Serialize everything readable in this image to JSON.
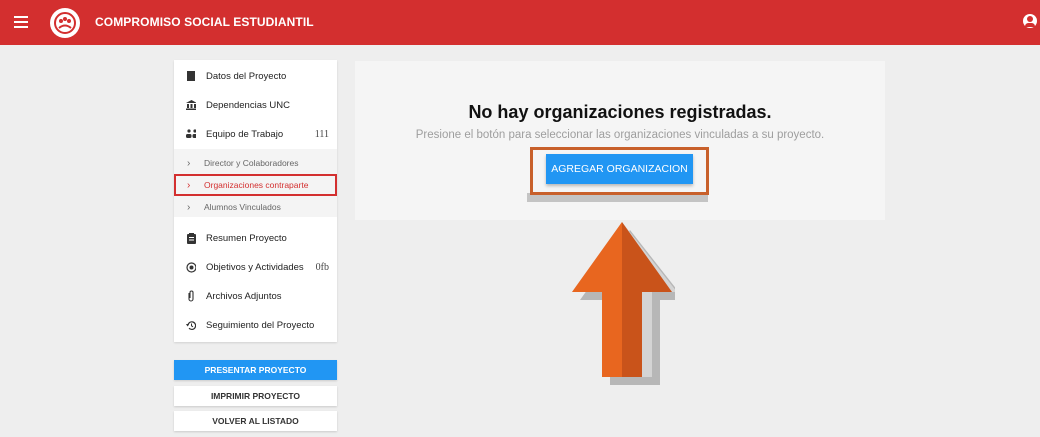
{
  "app": {
    "title": "COMPROMISO SOCIAL ESTUDIANTIL"
  },
  "header": {
    "menu_icon": "hamburger-icon",
    "user_icon": "user-icon"
  },
  "sidebar": {
    "items": [
      {
        "label": "Datos del Proyecto",
        "icon": "book-icon",
        "badge": ""
      },
      {
        "label": "Dependencias UNC",
        "icon": "institution-icon",
        "badge": ""
      },
      {
        "label": "Equipo de Trabajo",
        "icon": "people-icon",
        "badge": "111"
      },
      {
        "label": "Resumen Proyecto",
        "icon": "clipboard-icon",
        "badge": ""
      },
      {
        "label": "Objetivos y Actividades",
        "icon": "target-icon",
        "badge": "0fb"
      },
      {
        "label": "Archivos Adjuntos",
        "icon": "paperclip-icon",
        "badge": ""
      },
      {
        "label": "Seguimiento del Proyecto",
        "icon": "history-icon",
        "badge": ""
      }
    ],
    "sub_items": [
      {
        "label": "Director y Colaboradores"
      },
      {
        "label": "Organizaciones contraparte"
      },
      {
        "label": "Alumnos Vinculados"
      }
    ]
  },
  "actions": {
    "present": "PRESENTAR PROYECTO",
    "print": "IMPRIMIR PROYECTO",
    "back": "VOLVER AL LISTADO"
  },
  "main": {
    "empty_title": "No hay organizaciones registradas.",
    "empty_subtitle": "Presione el botón para seleccionar las organizaciones vinculadas a su proyecto.",
    "add_button": "AGREGAR ORGANIZACION"
  },
  "colors": {
    "brand_red": "#d32f2f",
    "primary_blue": "#2196f3",
    "arrow_orange": "#e8661f"
  }
}
